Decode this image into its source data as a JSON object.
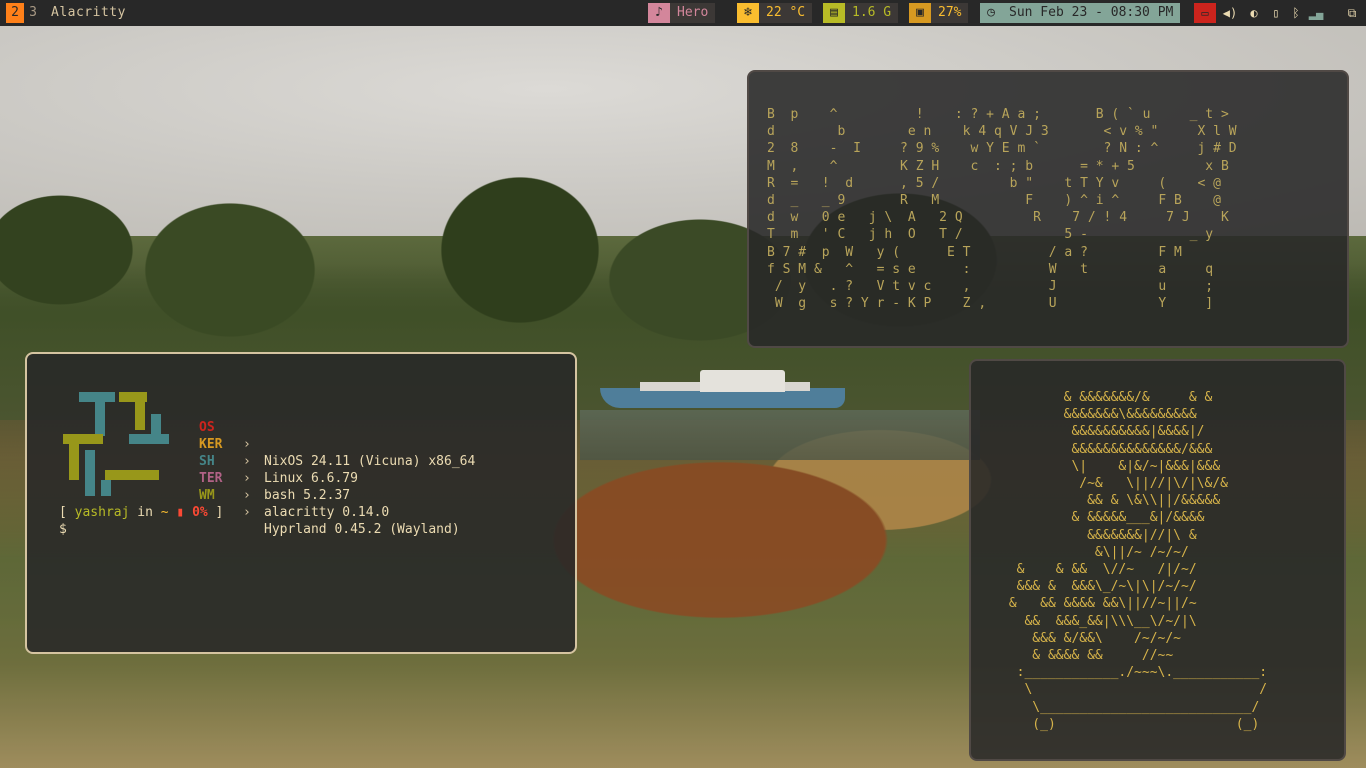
{
  "workspaces": {
    "active": "2",
    "other": "3"
  },
  "window_title": "Alacritty",
  "modules": {
    "music": {
      "icon": "music-icon",
      "text": "Hero"
    },
    "temperature": {
      "icon": "snowflake-icon",
      "text": "22 °C"
    },
    "memory": {
      "icon": "memory-icon",
      "text": "1.6 G"
    },
    "cpu": {
      "icon": "cpu-icon",
      "text": "27%"
    },
    "clock": {
      "icon": "clock-icon",
      "text": "Sun Feb 23 - 08:30 PM"
    }
  },
  "colors": {
    "bar_bg": "#282828",
    "accent_orange": "#fe8019",
    "music_pink": "#d3869b",
    "temp_yellow": "#fabd2f",
    "mem_green": "#b8bb26",
    "cpu_gold": "#d79921",
    "clock_teal": "#83a598",
    "red": "#cc241d",
    "border_active": "#d5c4a1"
  },
  "fastfetch": {
    "rows": [
      {
        "key": "OS",
        "color": "#cc241d",
        "arrow": "›",
        "value": "NixOS 24.11 (Vicuna) x86_64"
      },
      {
        "key": "KER",
        "color": "#d79921",
        "arrow": "›",
        "value": "Linux 6.6.79"
      },
      {
        "key": "SH",
        "color": "#458588",
        "arrow": "›",
        "value": "bash 5.2.37"
      },
      {
        "key": "TER",
        "color": "#b16286",
        "arrow": "›",
        "value": "alacritty 0.14.0"
      },
      {
        "key": "WM",
        "color": "#98971a",
        "arrow": "›",
        "value": "Hyprland 0.45.2 (Wayland)"
      }
    ]
  },
  "prompt": {
    "open": "[ ",
    "user": "yashraj",
    "in": " in ",
    "dir": "~",
    "battery_icon": "battery-icon",
    "battery": "0%",
    "close": " ]",
    "symbol": "$"
  },
  "matrix_rain": "B  p    ^          !    : ? + A a ;       B ( ` u     _ t >\nd        b        e n    k 4 q V J 3       < v % \"     X l W\n2  8    -  I     ? 9 %    w Y E m `        ? N : ^     j # D\nM  ,    ^        K Z H    c  : ; b      = * + 5         x B\nR  =   !  d      , 5 /         b \"    t T Y v     (    < @\nd  _   _ 9       R   M           F    ) ^ i ^     F B    @\nd  w   0 e   j \\  A   2 Q         R    7 / ! 4     7 J    K\nT  m   ' C   j h  O   T /             5 -             _ y\nB 7 #  p  W   y (      E T          / a ?         F M\nf S M &   ^   = s e      :          W   t         a     q\n /  y   . ?   V t v c    ,          J             u     ;\n W  g   s ? Y r - K P    Z ,        U             Y     ]",
  "bathtub_art": "        & &&&&&&&/&     & &\n        &&&&&&&\\&&&&&&&&&\n         &&&&&&&&&&|&&&&|/\n         &&&&&&&&&&&&&&/&&&\n         \\|    &|&/~|&&&|&&&\n          /~&   \\||//|\\/|\\&/&\n           && & \\&\\\\||/&&&&&\n         & &&&&&___&|/&&&&\n           &&&&&&&|//|\\ &\n            &\\||/~ /~/~/\n  &    & &&  \\//~   /|/~/\n  &&& &  &&&\\_/~\\|\\|/~/~/\n &   && &&&& &&\\||//~||/~\n   &&  &&&_&&|\\\\\\__\\/~/|\\\n    &&& &/&&\\    /~/~/~\n    & &&&& &&     //~~\n  :____________./~~~\\.___________:\n   \\                             /\n    \\___________________________/\n    (_)                       (_)"
}
